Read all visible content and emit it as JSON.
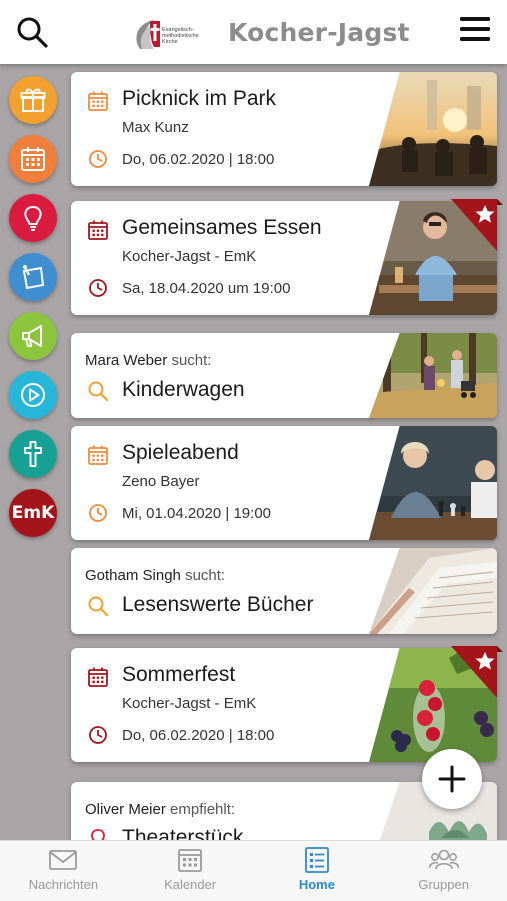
{
  "header": {
    "title": "Kocher-Jagst",
    "logo_text": [
      "Evangelisch-",
      "methodistische",
      "Kirche"
    ]
  },
  "sidebar": {
    "categories": [
      {
        "icon": "gift-icon",
        "color": "#f2a12e"
      },
      {
        "icon": "calendar-icon",
        "color": "#f07f3c"
      },
      {
        "icon": "lightbulb-icon",
        "color": "#d81b3e"
      },
      {
        "icon": "note-icon",
        "color": "#3f8ecf"
      },
      {
        "icon": "megaphone-icon",
        "color": "#8cc43e"
      },
      {
        "icon": "play-icon",
        "color": "#26b7d8"
      },
      {
        "icon": "cross-icon",
        "color": "#17a195"
      },
      {
        "icon": "emk-icon",
        "label": "EmK",
        "color": "#a4151b"
      }
    ]
  },
  "feed": [
    {
      "type": "event",
      "title": "Picknick im Park",
      "subtitle": "Max Kunz",
      "date": "Do, 06.02.2020 | 18:00",
      "accent": "#f08a3c",
      "starred": false
    },
    {
      "type": "event",
      "title": "Gemeinsames Essen",
      "subtitle": "Kocher-Jagst - EmK",
      "date": "Sa, 18.04.2020 um 19:00",
      "accent": "#a4151b",
      "starred": true
    },
    {
      "type": "search",
      "person": "Mara Weber",
      "verb": "sucht:",
      "title": "Kinderwagen",
      "accent": "#f2a12e"
    },
    {
      "type": "event",
      "title": "Spieleabend",
      "subtitle": "Zeno Bayer",
      "date": "Mi, 01.04.2020 | 19:00",
      "accent": "#f08a3c",
      "starred": false
    },
    {
      "type": "search",
      "person": "Gotham Singh",
      "verb": "sucht:",
      "title": "Lesenswerte Bücher",
      "accent": "#f2a12e"
    },
    {
      "type": "event",
      "title": "Sommerfest",
      "subtitle": "Kocher-Jagst - EmK",
      "date": "Do, 06.02.2020 | 18:00",
      "accent": "#a4151b",
      "starred": true
    },
    {
      "type": "recommend",
      "person": "Oliver Meier",
      "verb": "empfiehlt:",
      "title": "Theaterstück",
      "accent": "#d81b3e"
    }
  ],
  "tabs": [
    {
      "label": "Nachrichten",
      "icon": "mail-icon",
      "active": false
    },
    {
      "label": "Kalender",
      "icon": "calendar-icon",
      "active": false
    },
    {
      "label": "Home",
      "icon": "list-icon",
      "active": true
    },
    {
      "label": "Gruppen",
      "icon": "group-icon",
      "active": false
    }
  ],
  "colors": {
    "accent_blue": "#2a8ad0",
    "brand_red": "#a4151b"
  }
}
